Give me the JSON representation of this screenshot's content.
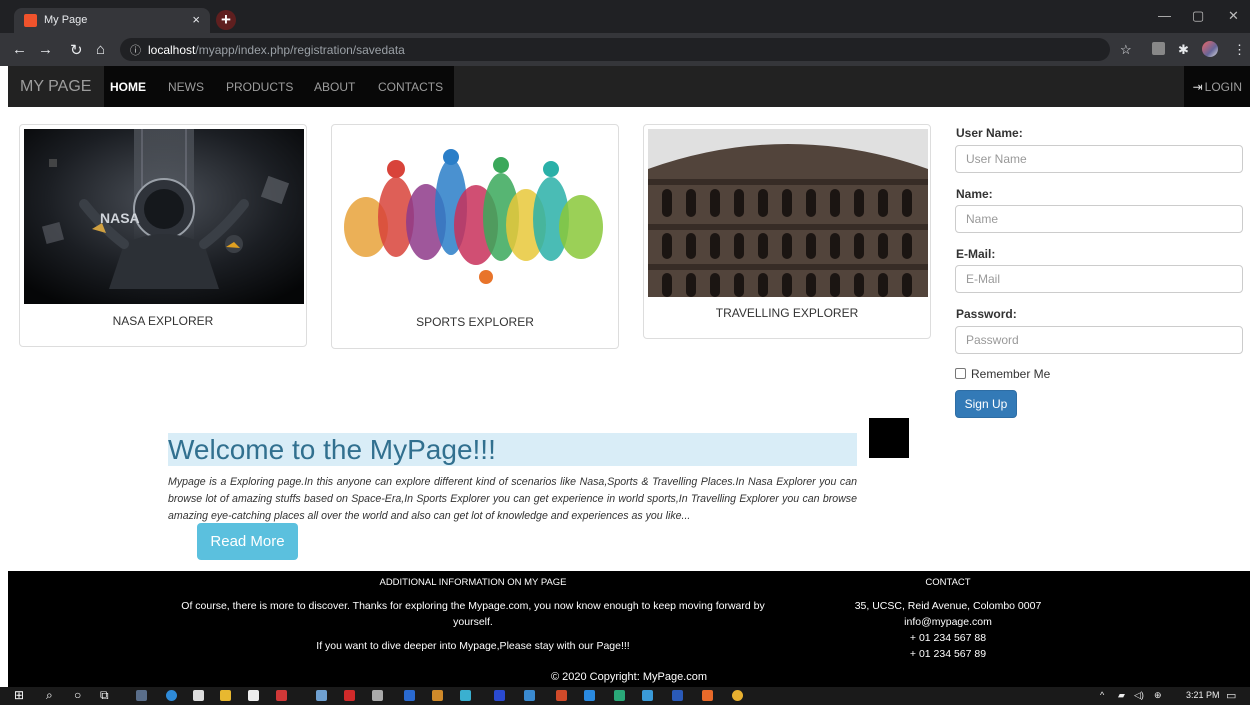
{
  "browser": {
    "tab_title": "My Page",
    "tab_close": "×",
    "new_tab": "+",
    "url_host": "localhost",
    "url_path": "/myapp/index.php/registration/savedata",
    "window_controls": [
      "—",
      "▢",
      "✕"
    ]
  },
  "navbar": {
    "brand": "MY PAGE",
    "links": [
      "HOME",
      "NEWS",
      "PRODUCTS",
      "ABOUT",
      "CONTACTS"
    ],
    "login": "LOGIN"
  },
  "cards": [
    {
      "caption": "NASA EXPLORER",
      "logo": "NASA"
    },
    {
      "caption": "SPORTS EXPLORER"
    },
    {
      "caption": "TRAVELLING EXPLORER"
    }
  ],
  "form": {
    "username_label": "User Name:",
    "username_placeholder": "User Name",
    "name_label": "Name:",
    "name_placeholder": "Name",
    "email_label": "E-Mail:",
    "email_placeholder": "E-Mail",
    "password_label": "Password:",
    "password_placeholder": "Password",
    "remember": "Remember Me",
    "submit": "Sign Up"
  },
  "welcome": {
    "heading": "Welcome to the MyPage!!!",
    "body": "Mypage is a Exploring page.In this anyone can explore different kind of scenarios like Nasa,Sports & Travelling Places.In Nasa Explorer you can browse lot of amazing stuffs based on Space-Era,In Sports Explorer you can get experience in world sports,In Travelling Explorer you can browse amazing eye-catching places all over the world and also can get lot of knowledge and experiences as you like...",
    "read_more": "Read More"
  },
  "footer": {
    "info_heading": "ADDITIONAL INFORMATION ON MY PAGE",
    "info_text_1": "Of course, there is more to discover. Thanks for exploring the Mypage.com, you now know enough to keep moving forward by yourself.",
    "info_text_2": "If you want to dive deeper into Mypage,Please stay with our Page!!!",
    "contact_heading": "CONTACT",
    "address": "35, UCSC, Reid Avenue, Colombo 0007",
    "email": "info@mypage.com",
    "phone_1": "+ 01 234 567 88",
    "phone_2": "+ 01 234 567 89",
    "copyright": "© 2020 Copyright: MyPage.com"
  },
  "taskbar": {
    "time": "3:21 PM"
  },
  "colors": {
    "navbar_bg": "#222222",
    "primary_button": "#337ab7",
    "info_button": "#5bc0de",
    "welcome_bg": "#d9edf7",
    "welcome_text": "#31708f"
  }
}
